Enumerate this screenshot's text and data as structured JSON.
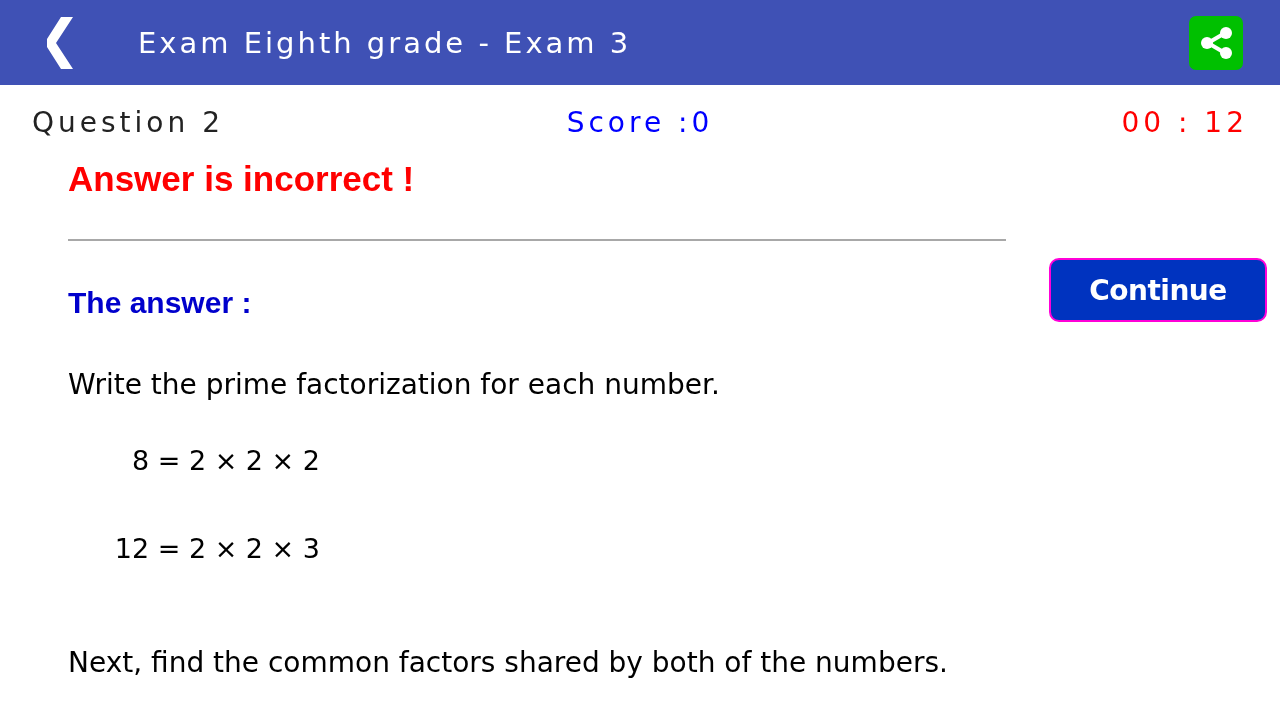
{
  "header": {
    "title": "Exam Eighth grade - Exam 3"
  },
  "status": {
    "question": "Question 2",
    "score": "Score :0",
    "timer": "00 : 12"
  },
  "result": {
    "message": "Answer is incorrect !",
    "correct": false
  },
  "answer": {
    "label": "The answer :",
    "continue_button": "Continue",
    "intro": "Write the prime factorization for each number.",
    "equations": [
      "8 = 2 × 2 × 2",
      "12 = 2 × 2 × 3"
    ],
    "next": "Next, find the common factors shared by both of the numbers."
  }
}
